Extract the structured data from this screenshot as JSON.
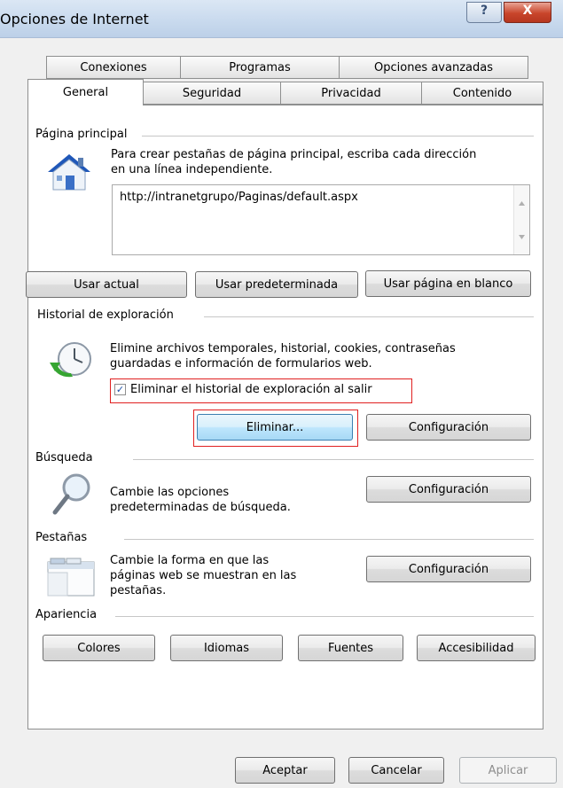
{
  "window": {
    "title": "Opciones de Internet",
    "help_glyph": "?",
    "close_glyph": "X"
  },
  "tabs": {
    "row_back": [
      "Conexiones",
      "Programas",
      "Opciones avanzadas"
    ],
    "row_front": [
      "General",
      "Seguridad",
      "Privacidad",
      "Contenido"
    ],
    "active": "General"
  },
  "home": {
    "section_label": "Página principal",
    "description": [
      "Para crear pestañas de página principal, escriba cada dirección",
      "en una línea independiente."
    ],
    "url_value": "http://intranetgrupo/Paginas/default.aspx",
    "use_current": "Usar actual",
    "use_default": "Usar predeterminada",
    "use_blank": "Usar página en blanco"
  },
  "history": {
    "section_label": "Historial de exploración",
    "description": [
      "Elimine archivos temporales, historial, cookies, contraseñas",
      "guardadas e información de formularios web."
    ],
    "checkbox_label": "Eliminar el historial de exploración al salir",
    "checkbox_checked": true,
    "delete_button": "Eliminar...",
    "settings_button": "Configuración"
  },
  "search": {
    "section_label": "Búsqueda",
    "description": [
      "Cambie las opciones",
      "predeterminadas de búsqueda."
    ],
    "settings_button": "Configuración"
  },
  "tabs_section": {
    "section_label": "Pestañas",
    "description": [
      "Cambie la forma en que las",
      "páginas web se muestran en las",
      "pestañas."
    ],
    "settings_button": "Configuración"
  },
  "appearance": {
    "section_label": "Apariencia",
    "colors": "Colores",
    "languages": "Idiomas",
    "fonts": "Fuentes",
    "accessibility": "Accesibilidad"
  },
  "footer": {
    "ok": "Aceptar",
    "cancel": "Cancelar",
    "apply": "Aplicar"
  },
  "colors": {
    "highlight_red": "#e02020",
    "focus_blue": "#3c7fb1"
  }
}
